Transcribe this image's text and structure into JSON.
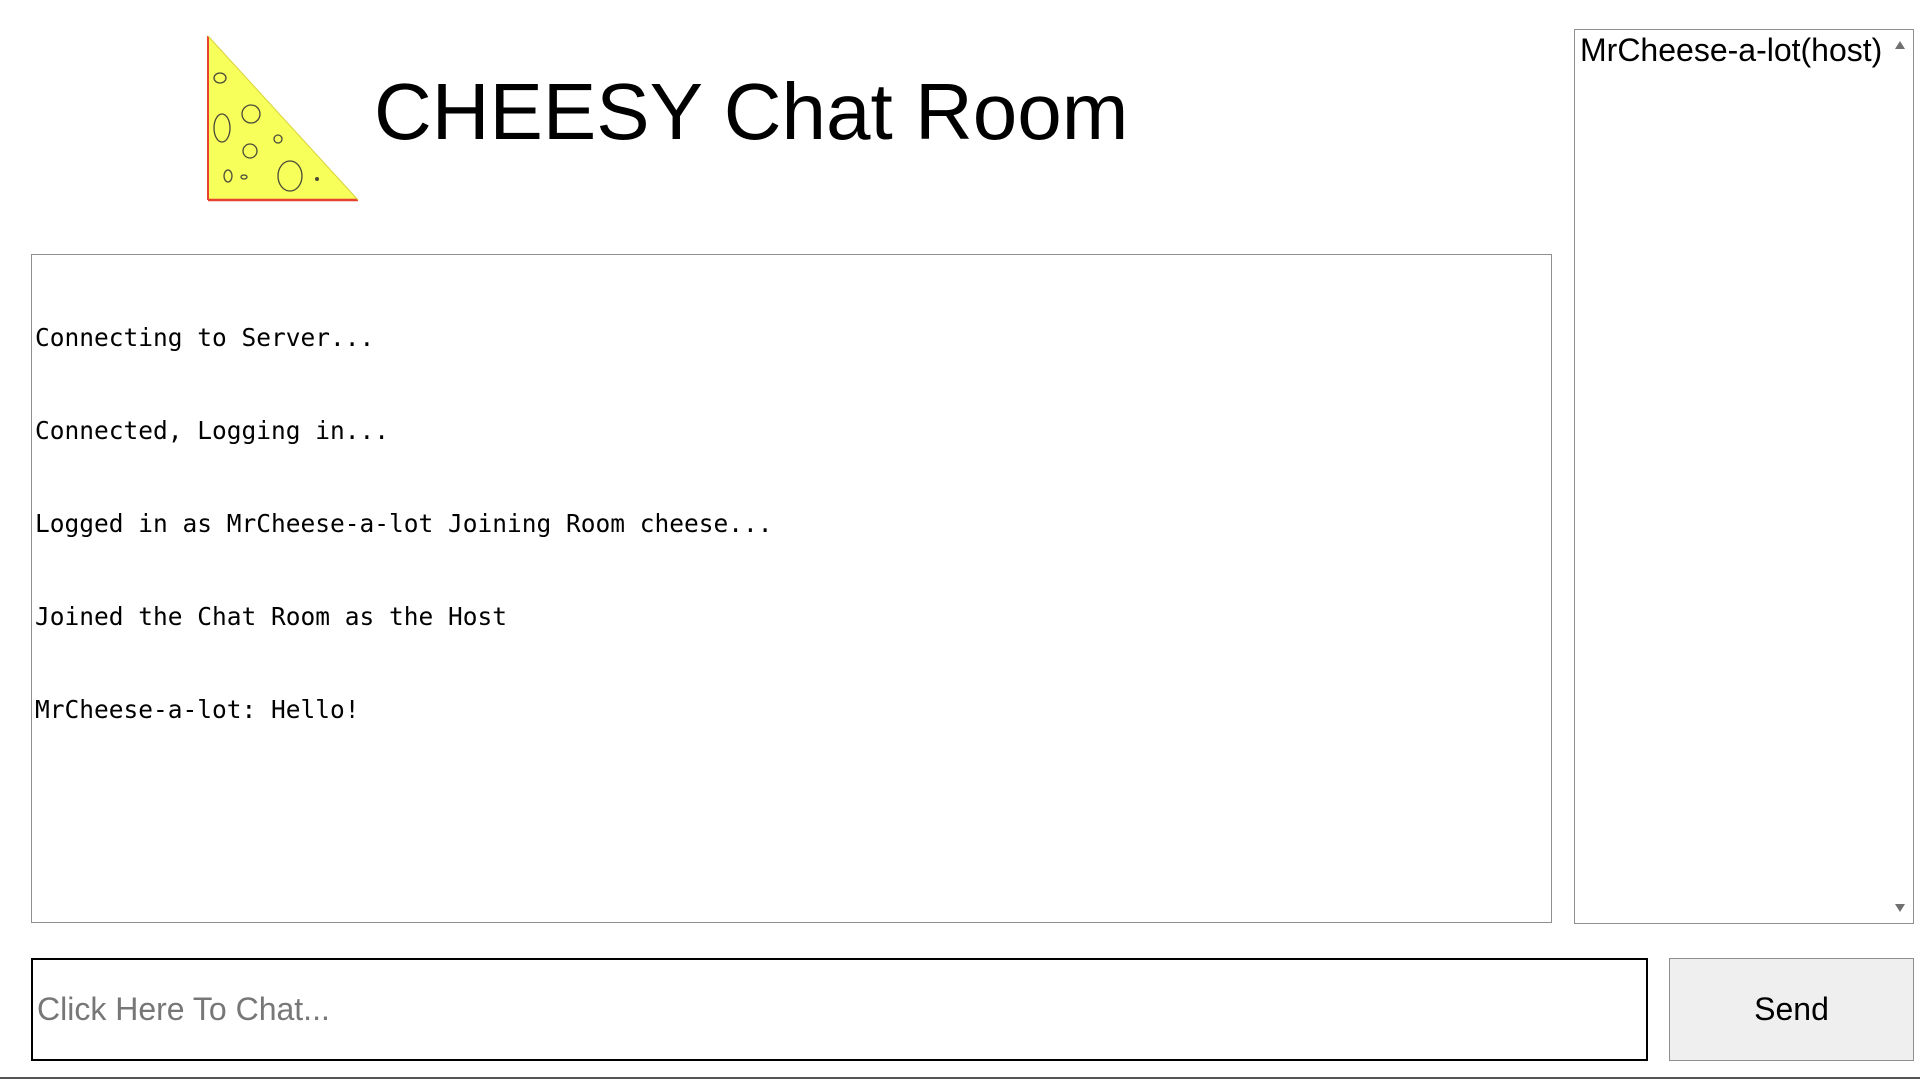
{
  "header": {
    "title": "CHEESY Chat Room",
    "logo_icon": "cheese-wedge-icon",
    "logo_fill": "#f7ff5a",
    "logo_edge": "#e8402e"
  },
  "chat_log": {
    "lines": [
      "Connecting to Server...",
      "Connected, Logging in...",
      "Logged in as MrCheese-a-lot Joining Room cheese...",
      "Joined the Chat Room as the Host",
      "MrCheese-a-lot: Hello!"
    ]
  },
  "user_list": {
    "users": [
      "MrCheese-a-lot(host)"
    ]
  },
  "composer": {
    "placeholder": "Click Here To Chat...",
    "value": "",
    "send_label": "Send"
  }
}
